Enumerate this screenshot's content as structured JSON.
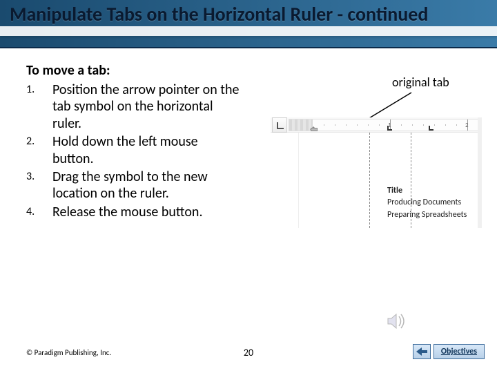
{
  "slide": {
    "title": "Manipulate Tabs on the Horizontal Ruler - continued"
  },
  "content": {
    "intro": "To move a tab:",
    "steps": [
      "Position the arrow pointer on the tab symbol on the horizontal ruler.",
      "Hold down the left mouse button.",
      "Drag the symbol to the new location on the ruler.",
      "Release the mouse button."
    ]
  },
  "callout": {
    "label": "original tab"
  },
  "screenshot": {
    "ruler_numbers": [
      "1",
      "2"
    ],
    "doc_lines": {
      "title": "Title",
      "line2": "Producing Documents",
      "line3": "Preparing Spreadsheets"
    }
  },
  "footer": {
    "copyright": "© Paradigm Publishing, Inc.",
    "page_number": "20",
    "objectives_label": "Objectives"
  }
}
